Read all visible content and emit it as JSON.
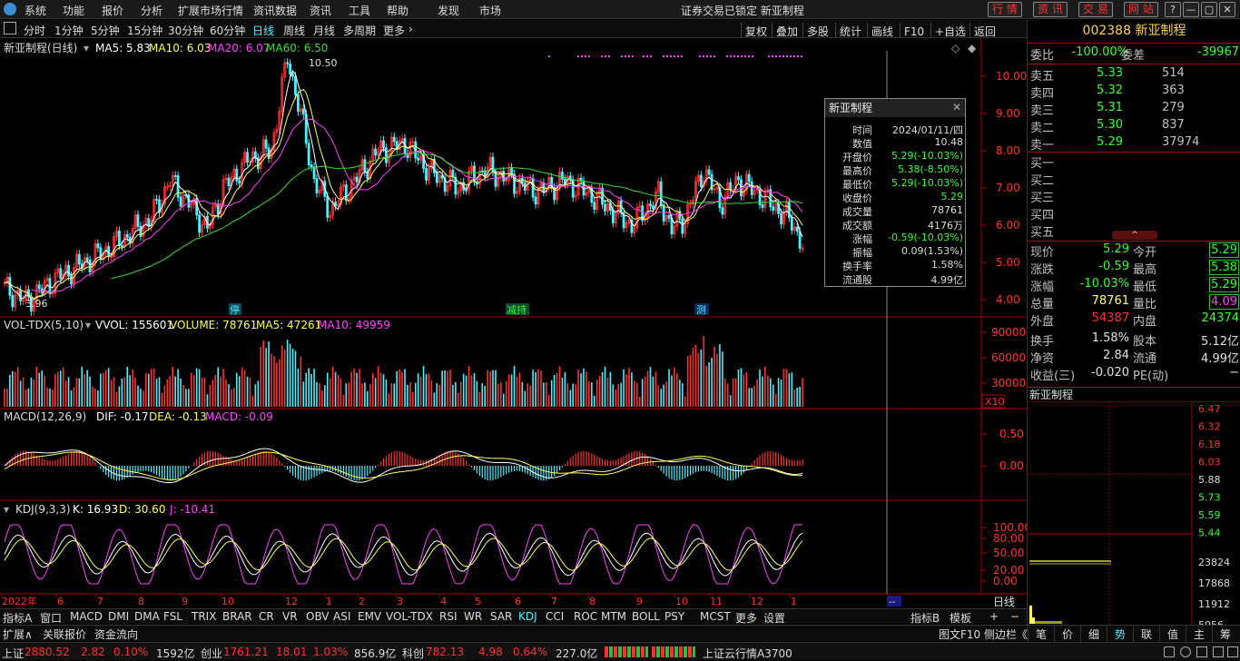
{
  "menu": [
    "系统",
    "功能",
    "报价",
    "分析",
    "扩展市场行情",
    "资讯数据",
    "资讯",
    "工具",
    "帮助"
  ],
  "menu_red": [
    "发现",
    "市场"
  ],
  "lock_notice": "证券交易已锁定  新亚制程",
  "top_buttons": [
    "行 情",
    "资 讯",
    "交 易",
    "网 站"
  ],
  "window_buttons": [
    "?",
    "—",
    "▢",
    "✕"
  ],
  "periods": [
    "分时",
    "1分钟",
    "5分钟",
    "15分钟",
    "30分钟",
    "60分钟",
    "日线",
    "周线",
    "月线",
    "多周期",
    "更多"
  ],
  "selected_period": "日线",
  "toolbar": [
    "复权",
    "叠加",
    "多股",
    "统计",
    "画线",
    "F10",
    "+自选",
    "返回"
  ],
  "chart_title": "新亚制程(日线)",
  "ma_labels": {
    "ma5": "MA5: 5.83",
    "ma10": "MA10: 6.03",
    "ma20": "MA20: 6.07",
    "ma60": "MA60: 6.50"
  },
  "price_axis": [
    "10.00",
    "9.00",
    "8.00",
    "7.00",
    "6.00",
    "5.00",
    "4.00"
  ],
  "high_label": "10.50",
  "low_label": "3.96",
  "event_markers": [
    "停",
    "减持",
    "测"
  ],
  "vol_header": {
    "name": "VOL-TDX(5,10)",
    "vvol": "VVOL: 155601",
    "volume": "VOLUME: 78761",
    "ma5": "MA5: 47261",
    "ma10": "MA10: 49959"
  },
  "vol_axis": [
    "90000",
    "60000",
    "30000"
  ],
  "vol_unit": "X10",
  "macd_header": {
    "name": "MACD(12,26,9)",
    "dif": "DIF: -0.17",
    "dea": "DEA: -0.13",
    "macd": "MACD: -0.09"
  },
  "macd_axis": [
    "0.50",
    "0.00"
  ],
  "kdj_header": {
    "name": "KDJ(9,3,3)",
    "k": "K: 16.93",
    "d": "D: 30.60",
    "j": "J: -10.41"
  },
  "kdj_axis": [
    "100.00",
    "80.00",
    "50.00",
    "20.00",
    "0.00"
  ],
  "date_axis": [
    "2022年",
    "6",
    "7",
    "8",
    "9",
    "10",
    "12",
    "1",
    "2",
    "3",
    "4",
    "5",
    "6",
    "7",
    "8",
    "9",
    "10",
    "11",
    "12",
    "1"
  ],
  "date_mode": "日线",
  "tooltip": {
    "title": "新亚制程",
    "rows": [
      [
        "时间",
        "2024/01/11/四"
      ],
      [
        "数值",
        "10.48"
      ],
      [
        "开盘价",
        "5.29(-10.03%)"
      ],
      [
        "最高价",
        "5.38(-8.50%)"
      ],
      [
        "最低价",
        "5.29(-10.03%)"
      ],
      [
        "收盘价",
        "5.29"
      ],
      [
        "成交量",
        "78761"
      ],
      [
        "成交额",
        "4176万"
      ],
      [
        "涨幅",
        "-0.59(-10.03%)"
      ],
      [
        "振幅",
        "0.09(1.53%)"
      ],
      [
        "换手率",
        "1.58%"
      ],
      [
        "流通股",
        "4.99亿"
      ]
    ]
  },
  "indicators": [
    "指标A",
    "窗口",
    "MACD",
    "DMI",
    "DMA",
    "FSL",
    "TRIX",
    "BRAR",
    "CR",
    "VR",
    "OBV",
    "ASI",
    "EMV",
    "VOL-TDX",
    "RSI",
    "WR",
    "SAR",
    "KDJ",
    "CCI",
    "ROC",
    "MTM",
    "BOLL",
    "PSY",
    "MCST",
    "更多",
    "设置"
  ],
  "indicator_selected": "KDJ",
  "ind_right": [
    "指标B",
    "模板",
    "+",
    "−"
  ],
  "bottom_tabs": [
    "扩展∧",
    "关联报价",
    "资金流向"
  ],
  "bottom_right": "图文F10  侧边栏《",
  "right_panel": {
    "code": "002388 新亚制程",
    "weibi": {
      "label": "委比",
      "value": "-100.00%",
      "label2": "委差",
      "value2": "-39967"
    },
    "sells": [
      [
        "卖五",
        "5.33",
        "514"
      ],
      [
        "卖四",
        "5.32",
        "363"
      ],
      [
        "卖三",
        "5.31",
        "279"
      ],
      [
        "卖二",
        "5.30",
        "837"
      ],
      [
        "卖一",
        "5.29",
        "37974"
      ]
    ],
    "buys": [
      "买一",
      "买二",
      "买三",
      "买四",
      "买五"
    ],
    "stats": [
      [
        "现价",
        "5.29",
        "今开",
        "5.29"
      ],
      [
        "涨跌",
        "-0.59",
        "最高",
        "5.38"
      ],
      [
        "涨幅",
        "-10.03%",
        "最低",
        "5.29"
      ],
      [
        "总量",
        "78761",
        "量比",
        "4.09"
      ],
      [
        "外盘",
        "54387",
        "内盘",
        "24374"
      ],
      [
        "换手",
        "1.58%",
        "股本",
        "5.12亿"
      ],
      [
        "净资",
        "2.84",
        "流通",
        "4.99亿"
      ],
      [
        "收益(三)",
        "-0.020",
        "PE(动)",
        "−"
      ]
    ],
    "mini_title": "新亚制程",
    "mini_axis": [
      "6.47",
      "6.32",
      "6.18",
      "6.03",
      "5.88",
      "5.73",
      "5.59",
      "5.44"
    ],
    "mini_vol_axis": [
      "23824",
      "17868",
      "11912",
      "5956"
    ],
    "tabs": [
      "笔",
      "价",
      "细",
      "势",
      "联",
      "值",
      "主",
      "筹"
    ]
  },
  "status": {
    "sh_label": "上证",
    "sh_val": "2880.52",
    "sh_chg": "2.82",
    "sh_pct": "0.10%",
    "sh_amt": "1592亿",
    "cy_label": "创业",
    "cy_val": "1761.21",
    "cy_chg": "18.01",
    "cy_pct": "1.03%",
    "cy_amt": "856.9亿",
    "kc_label": "科创",
    "kc_val": "782.13",
    "kc_chg": "4.98",
    "kc_pct": "0.64%",
    "kc_amt": "227.0亿",
    "server": "上证云行情A3700"
  },
  "colors": {
    "up": "#ff3030",
    "down": "#4df0ff",
    "ma5": "#ffffff",
    "ma10": "#ffff50",
    "ma20": "#ff40ff",
    "ma60": "#30e030"
  }
}
